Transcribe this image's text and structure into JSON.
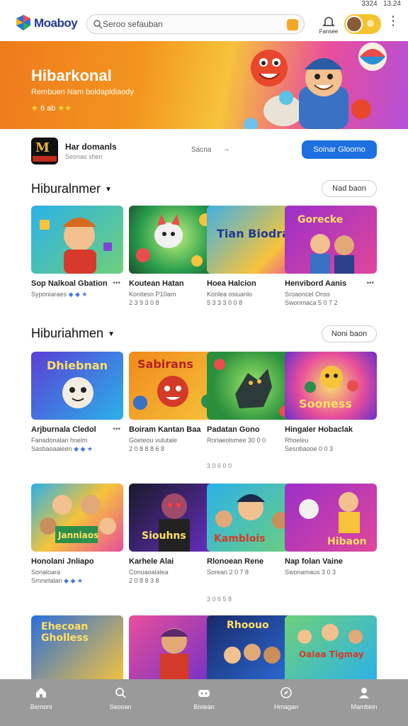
{
  "status": {
    "time": "3324",
    "clock": "13.24"
  },
  "header": {
    "logo_text": "Moaboy",
    "search_placeholder": "Seroo sefauban",
    "bell_label": "Fansee"
  },
  "hero": {
    "title": "Hibarkonal",
    "subtitle": "Rembuen Nam  boldapldiaody",
    "rating_text": "6 ab"
  },
  "featured": {
    "name": "Har domanls",
    "sub": "Seonas shen",
    "mid_text": "Sacna",
    "arrow": "→",
    "button": "Soinar Gloomo"
  },
  "sections": [
    {
      "title": "Hiburalnmer",
      "more": "Nad baon"
    },
    {
      "title": "Hiburiahmen",
      "more": "Noni baon"
    }
  ],
  "row1": [
    {
      "title": "Sop Nalkoal Gbation",
      "line2": "Syponiaraes",
      "line3": "",
      "tile": ""
    },
    {
      "title": "Koutean Hatan",
      "line2": "Konitesn P10arn",
      "line3": "2 3 9 3 0 8",
      "tile": ""
    },
    {
      "title": "Hoea Halcion",
      "line2": "Konlea osiuanlo",
      "line3": "5 3 3 3 0 0 8",
      "tile": "Tian Biodrao"
    },
    {
      "title": "Henvibord Aanis",
      "line2": "Sroaoncel Onss",
      "line3": "Swonmaca 5 0 7 2",
      "tile": "Gorecke"
    }
  ],
  "row2": [
    {
      "title": "Arjburnala Cledol",
      "line2": "Fanadonalan hnelm",
      "line3": "Sasbaoaaieen",
      "tile": "Dhiebnan"
    },
    {
      "title": "Boiram Kantan  Baa",
      "line2": "Goeteou vulutale",
      "line3": "2 0 8 8 8 6 8",
      "tile": "Sabirans"
    },
    {
      "title": "Padatan Gono",
      "line2": "Rnriaeolsmee 30 0 0",
      "line3": "",
      "tile": ""
    },
    {
      "title": "Hingaler Hobaclak",
      "line2": "Rhoeleu",
      "line3": "Sesnbaooe 0 0 3",
      "tile": "Sooness"
    }
  ],
  "pager1": "3 0 6 0 0",
  "row3": [
    {
      "title": "Honolani Jnliapo",
      "line2": "Sonaloara",
      "line3": "Srnnetalan",
      "tile": "Janniaos"
    },
    {
      "title": "Karhele Alai",
      "line2": "Conuaoalalea",
      "line3": "2 0 8 8 3 8",
      "tile": "Siouhns"
    },
    {
      "title": "Rlonoean Rene",
      "line2": "Sorean 2 0 7 8",
      "line3": "",
      "tile": "Kamblois"
    },
    {
      "title": "Nap folan Vaine",
      "line2": "Swonamaus 3 0 3",
      "line3": "",
      "tile": "Hibaon"
    }
  ],
  "pager2": "3 0 6 5 8",
  "row4": [
    {
      "tile": "Ehecoan Gholless"
    },
    {
      "tile": ""
    },
    {
      "tile": "Rhoouo"
    },
    {
      "tile": "Oaiaa Tigmay"
    }
  ],
  "nav": [
    {
      "label": "Bemoni",
      "icon": "home-icon"
    },
    {
      "label": "Seooan",
      "icon": "search-icon"
    },
    {
      "label": "Bisiean",
      "icon": "gamepad-icon"
    },
    {
      "label": "Hmagan",
      "icon": "compass-icon"
    },
    {
      "label": "Mambion",
      "icon": "profile-icon"
    }
  ],
  "colors": {
    "accent": "#1e6fe0",
    "nav_bg": "#9a9a9a",
    "hero_start": "#ee7a1c",
    "hero_end": "#b34fd8"
  }
}
